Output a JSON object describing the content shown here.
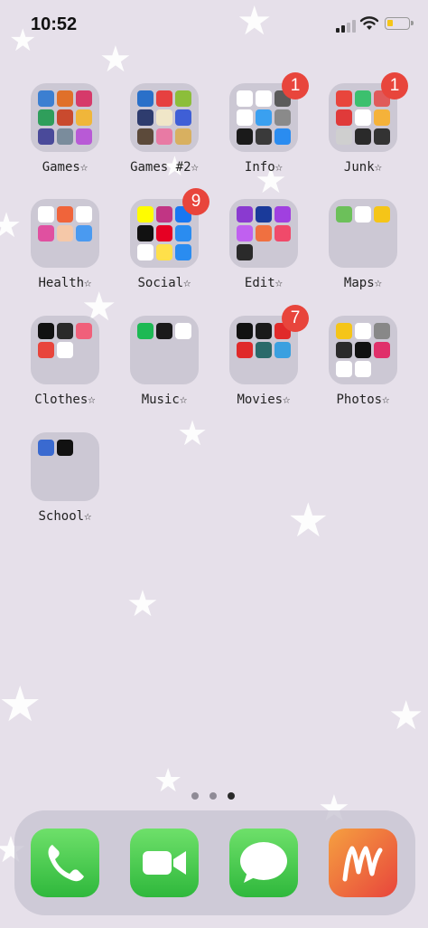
{
  "status_bar": {
    "time": "10:52"
  },
  "folders": [
    {
      "label": "Games☆",
      "badge": "",
      "apps": [
        "#3c7fd1",
        "#e0702a",
        "#d63a6a",
        "#2f9e5b",
        "#c94a2e",
        "#f0b63a",
        "#4a4a9a",
        "#7a8c9c",
        "#b85ad6"
      ]
    },
    {
      "label": "Games #2☆",
      "badge": "",
      "apps": [
        "#2a70c9",
        "#e64040",
        "#8cbe3a",
        "#2e3c6e",
        "#f0e6c8",
        "#3f5fd6",
        "#5c4a3a",
        "#e87aa4",
        "#d8b060"
      ]
    },
    {
      "label": "Info☆",
      "badge": "1",
      "apps": [
        "#ffffff",
        "#ffffff",
        "#5b5b5b",
        "#ffffff",
        "#3aa0f0",
        "#8a8a8a",
        "#1a1a1a",
        "#3a3a3a",
        "#2a8cf0"
      ]
    },
    {
      "label": "Junk☆",
      "badge": "1",
      "apps": [
        "#e8453c",
        "#3cc06e",
        "#e05a5a",
        "#e03a3a",
        "#ffffff",
        "#f5b23a",
        "#cfcfcf",
        "#2a2a2a",
        "#333333"
      ]
    },
    {
      "label": "Health☆",
      "badge": "",
      "apps": [
        "#ffffff",
        "#f0643a",
        "#ffffff",
        "#e050a0",
        "#f5c8a8",
        "#4a9af0"
      ]
    },
    {
      "label": "Social☆",
      "badge": "9",
      "apps": [
        "#fffc00",
        "#c13584",
        "#1877f2",
        "#111111",
        "#e60023",
        "#2a8cf0",
        "#ffffff",
        "#ffe04a",
        "#2a8cf0"
      ]
    },
    {
      "label": "Edit☆",
      "badge": "",
      "apps": [
        "#8a3ad0",
        "#1a3a9a",
        "#a040e0",
        "#c060f0",
        "#f07040",
        "#f04a6a",
        "#2a2a2a"
      ]
    },
    {
      "label": "Maps☆",
      "badge": "",
      "apps": [
        "#6cc05a",
        "#ffffff",
        "#f5c518"
      ]
    },
    {
      "label": "Clothes☆",
      "badge": "",
      "apps": [
        "#111111",
        "#2a2a2a",
        "#f0607a",
        "#e8453c",
        "#ffffff"
      ]
    },
    {
      "label": "Music☆",
      "badge": "",
      "apps": [
        "#1db954",
        "#1a1a1a",
        "#ffffff"
      ]
    },
    {
      "label": "Movies☆",
      "badge": "7",
      "apps": [
        "#111111",
        "#1a1a1a",
        "#e02a2a",
        "#e02a2a",
        "#2a6a6a",
        "#3aa0e0"
      ]
    },
    {
      "label": "Photos☆",
      "badge": "",
      "apps": [
        "#f5c518",
        "#ffffff",
        "#888888",
        "#2a2a2a",
        "#111111",
        "#e0306a",
        "#ffffff",
        "#ffffff"
      ]
    },
    {
      "label": "School☆",
      "badge": "",
      "apps": [
        "#3a6ad0",
        "#111111"
      ]
    }
  ],
  "dock": [
    {
      "name": "Phone",
      "icon": "phone-icon",
      "color": "#3cc84a"
    },
    {
      "name": "FaceTime",
      "icon": "facetime-icon",
      "color": "#3cc84a"
    },
    {
      "name": "Messages",
      "icon": "messages-icon",
      "color": "#3cc84a"
    },
    {
      "name": "Music app",
      "icon": "music-m-icon",
      "color": "#f06040"
    }
  ],
  "colors": {
    "wallpaper": "#e6e0ea",
    "badge": "#e8453c"
  }
}
